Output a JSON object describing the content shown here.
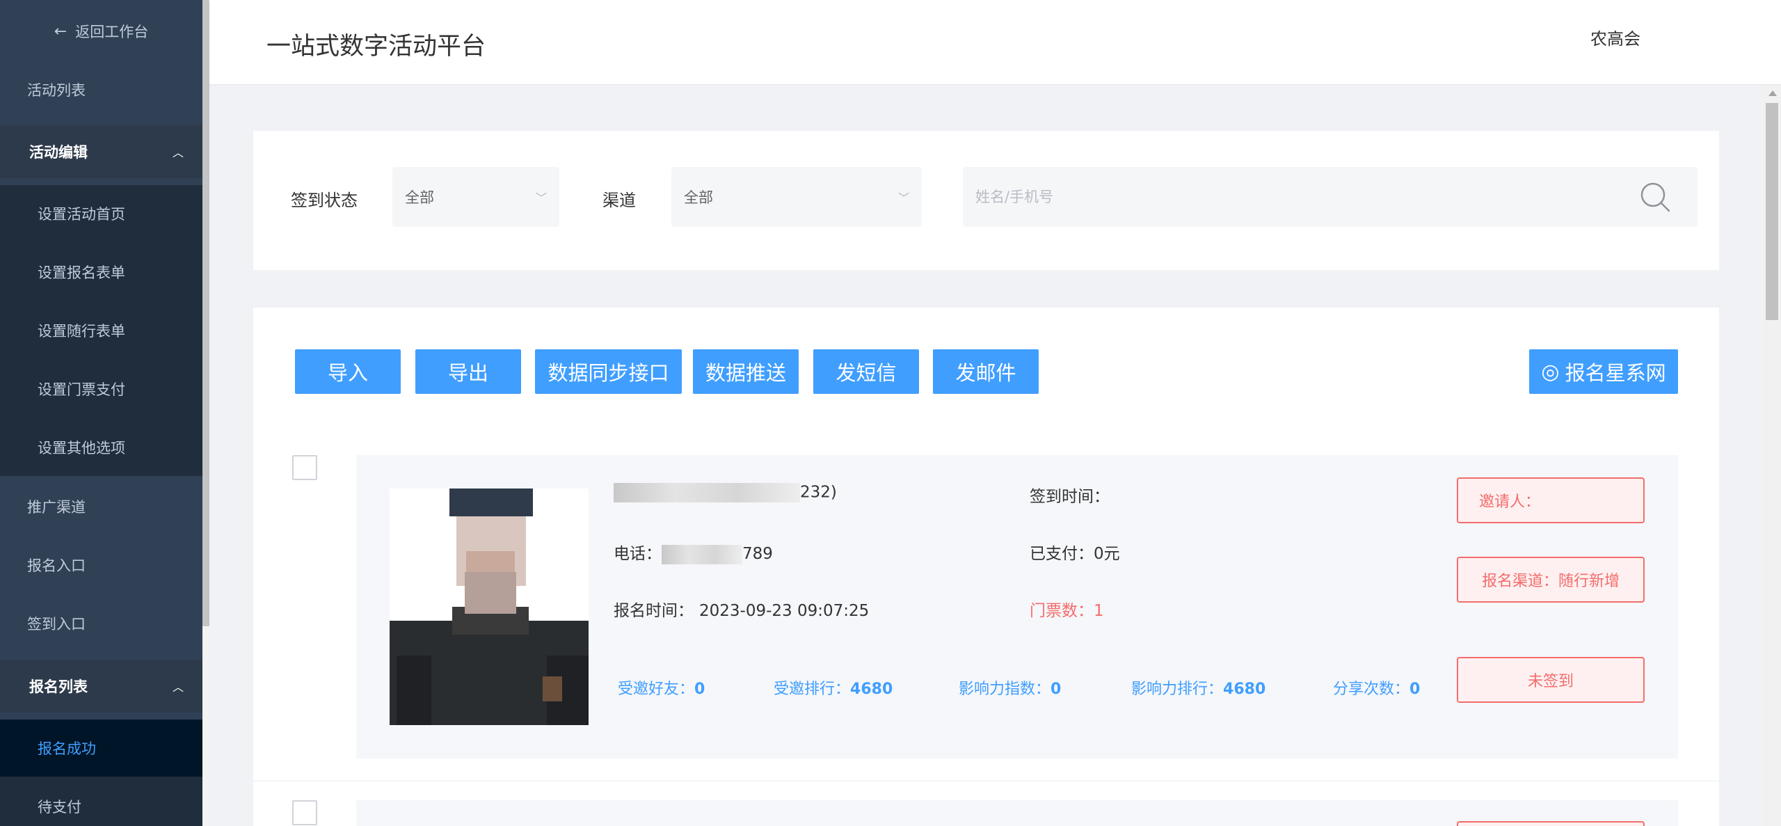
{
  "sidebar": {
    "back_label": "返回工作台",
    "activity_list": "活动列表",
    "edit_group": "活动编辑",
    "edit_items": [
      "设置活动首页",
      "设置报名表单",
      "设置随行表单",
      "设置门票支付",
      "设置其他选项"
    ],
    "promo_channel": "推广渠道",
    "signup_entry": "报名入口",
    "checkin_entry": "签到入口",
    "signup_group": "报名列表",
    "signup_items": [
      "报名成功",
      "待支付"
    ]
  },
  "header": {
    "title": "一站式数字活动平台",
    "user": "农高会"
  },
  "filters": {
    "checkin_label": "签到状态",
    "checkin_value": "全部",
    "channel_label": "渠道",
    "channel_value": "全部",
    "search_placeholder": "姓名/手机号",
    "search_value": ""
  },
  "toolbar": {
    "import": "导入",
    "export": "导出",
    "sync": "数据同步接口",
    "push": "数据推送",
    "sms": "发短信",
    "email": "发邮件",
    "brand": "报名星系网"
  },
  "records": [
    {
      "name_suffix": "232)",
      "phone_label": "电话：",
      "phone_suffix": "789",
      "signup_time_label": "报名时间：",
      "signup_time": "2023-09-23 09:07:25",
      "checkin_time_label": "签到时间：",
      "checkin_time": "",
      "paid_label": "已支付：",
      "paid": "0元",
      "tickets_label": "门票数：",
      "tickets": "1",
      "stats": [
        {
          "label": "受邀好友：",
          "value": "0"
        },
        {
          "label": "受邀排行：",
          "value": "4680"
        },
        {
          "label": "影响力指数：",
          "value": "0"
        },
        {
          "label": "影响力排行：",
          "value": "4680"
        },
        {
          "label": "分享次数：",
          "value": "0"
        }
      ],
      "inviter_label": "邀请人：",
      "inviter": "",
      "channel_tag": "报名渠道：随行新增",
      "status_tag": "未签到"
    }
  ],
  "colors": {
    "sidebar_bg": "#304156",
    "submenu_bg": "#1f2d3d",
    "accent": "#409eff",
    "danger": "#f56c6c"
  }
}
